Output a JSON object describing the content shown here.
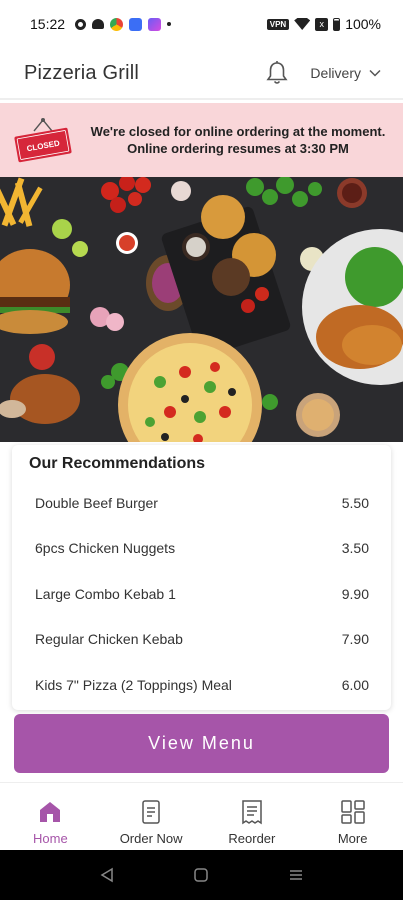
{
  "status_bar": {
    "time": "15:22",
    "vpn": "VPN",
    "sim": "x",
    "battery": "100%"
  },
  "header": {
    "restaurant_name": "Pizzeria Grill",
    "delivery_mode": "Delivery"
  },
  "banner": {
    "sign_text": "CLOSED",
    "line1": "We're closed for online ordering at the moment.",
    "line2": "Online ordering resumes at 3:30 PM"
  },
  "recommendations": {
    "title": "Our Recommendations",
    "items": [
      {
        "name": "Double Beef Burger",
        "price": "5.50"
      },
      {
        "name": "6pcs Chicken Nuggets",
        "price": "3.50"
      },
      {
        "name": "Large Combo Kebab 1",
        "price": "9.90"
      },
      {
        "name": "Regular Chicken Kebab",
        "price": "7.90"
      },
      {
        "name": "Kids 7\" Pizza (2 Toppings) Meal",
        "price": "6.00"
      }
    ]
  },
  "view_menu_label": "View Menu",
  "bottom_nav": {
    "items": [
      {
        "label": "Home",
        "icon": "home-icon",
        "active": true
      },
      {
        "label": "Order Now",
        "icon": "order-icon",
        "active": false
      },
      {
        "label": "Reorder",
        "icon": "receipt-icon",
        "active": false
      },
      {
        "label": "More",
        "icon": "grid-icon",
        "active": false
      }
    ]
  },
  "colors": {
    "accent": "#a655a9",
    "banner_bg": "#f9d6d9",
    "closed_sign": "#d6263a"
  }
}
